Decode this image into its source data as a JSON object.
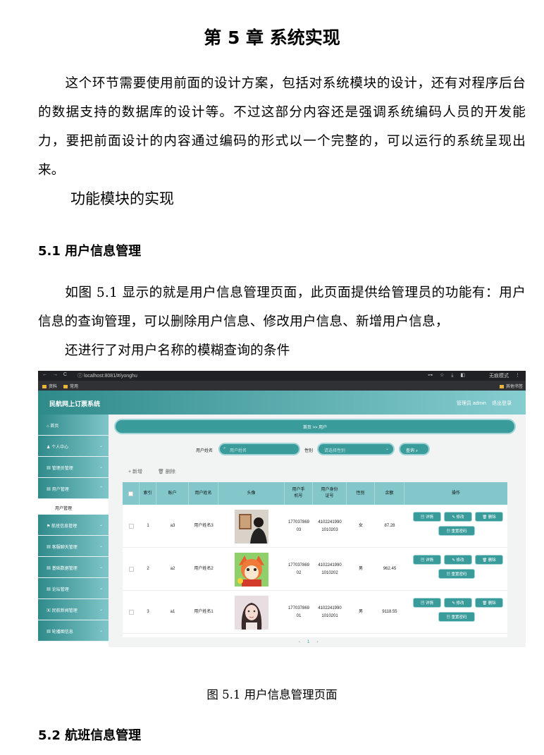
{
  "chapter_title": "第 5 章  系统实现",
  "intro_paragraph": "这个环节需要使用前面的设计方案，包括对系统模块的设计，还有对程序后台的数据支持的数据库的设计等。不过这部分内容还是强调系统编码人员的开发能力，要把前面设计的内容通过编码的形式以一个完整的，可以运行的系统呈现出来。",
  "subheading": "功能模块的实现",
  "section_5_1": {
    "title": "5.1 用户信息管理",
    "paragraph": "如图 5.1 显示的就是用户信息管理页面，此页面提供给管理员的功能有：用户信息的查询管理，可以删除用户信息、修改用户信息、新增用户信息，",
    "paragraph2": "还进行了对用户名称的模糊查询的条件"
  },
  "figure": {
    "caption": "图 5.1  用户信息管理页面",
    "browser": {
      "nav": "← → C",
      "url": "ⓘ localhost:8081/#/yonghu",
      "right_icons": "⊶ ☆ ⤓ ◧",
      "incognito": "无痕模式",
      "menu": "⋮",
      "bookmarks": [
        "资料",
        "常用"
      ],
      "other_bookmarks": "其他书签"
    },
    "app": {
      "brand": "民航网上订票系统",
      "admin_label": "管理员 admin",
      "logout": "退出登录",
      "sidebar": [
        {
          "icon": "⌂",
          "label": "首页"
        },
        {
          "icon": "♟",
          "label": "个人中心"
        },
        {
          "icon": "▦",
          "label": "管理员管理"
        },
        {
          "icon": "▦",
          "label": "用户管理"
        },
        {
          "icon": "⚑",
          "label": "航班信息管理"
        },
        {
          "icon": "▦",
          "label": "客服聊天管理"
        },
        {
          "icon": "▦",
          "label": "基础数据管理"
        },
        {
          "icon": "▦",
          "label": "论坛管理"
        },
        {
          "icon": "▣",
          "label": "民航新闻管理"
        },
        {
          "icon": "▦",
          "label": "轮播图信息"
        }
      ],
      "sidebar_sub": "用户管理",
      "chevron": "⌄",
      "breadcrumb": "首页  >>  用户",
      "search": {
        "name_label": "用户姓名",
        "name_placeholder": "用户姓名",
        "gender_label": "性别",
        "gender_placeholder": "请选择性别",
        "button": "查询"
      },
      "add_label": "+ 新增",
      "delete_label": "🗑 删除",
      "columns": [
        "索引",
        "账户",
        "用户姓名",
        "头像",
        "用户手机号",
        "用户身份证号",
        "性别",
        "余额",
        "操作"
      ],
      "rows": [
        {
          "index": "1",
          "account": "a3",
          "name": "用户姓名3",
          "phone": "17703786903",
          "id_card": "41022419901010203",
          "gender": "女",
          "balance": "87.28"
        },
        {
          "index": "2",
          "account": "a2",
          "name": "用户姓名2",
          "phone": "17703786902",
          "id_card": "41022419901010202",
          "gender": "男",
          "balance": "962.45"
        },
        {
          "index": "3",
          "account": "a1",
          "name": "用户姓名1",
          "phone": "17703786901",
          "id_card": "41022419901010201",
          "gender": "男",
          "balance": "9118.55"
        }
      ],
      "row_buttons": {
        "detail": "▤ 详情",
        "edit": "✎ 修改",
        "delete": "🗑 删除",
        "reset": "▤ 重置密码"
      },
      "pager": {
        "prev": "‹",
        "current": "1",
        "next": "›"
      }
    }
  },
  "section_5_2": {
    "title": "5.2  航班信息管理"
  }
}
